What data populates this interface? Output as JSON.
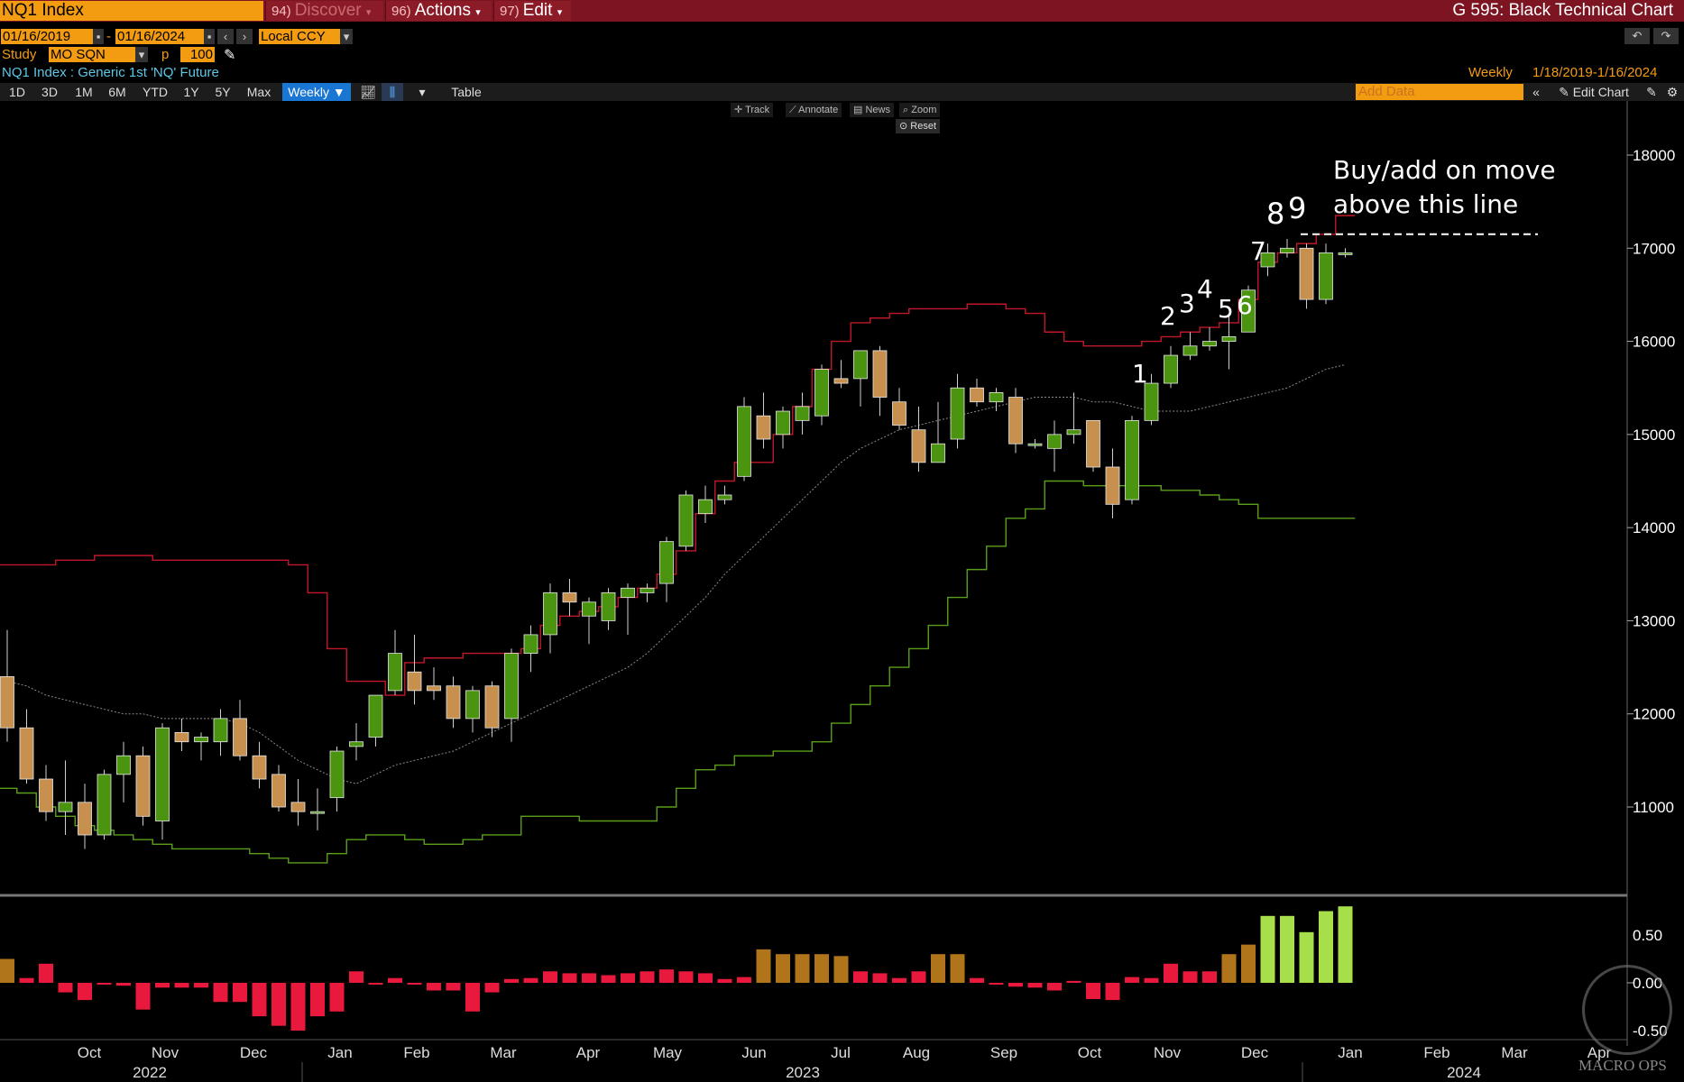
{
  "topbar": {
    "ticker": "NQ1 Index",
    "discover": "Discover",
    "discover_num": "94)",
    "actions": "Actions",
    "actions_num": "96)",
    "edit": "Edit",
    "edit_num": "97)",
    "function_title": "G 595: Black Technical Chart"
  },
  "row2": {
    "start_date": "01/16/2019",
    "end_date": "01/16/2024",
    "currency": "Local CCY",
    "study_label": "Study",
    "study_value": "MO SQN",
    "p_label": "p",
    "p_value": "100"
  },
  "row3": {
    "security_desc": "NQ1 Index : Generic 1st 'NQ' Future",
    "frequency": "Weekly",
    "date_range": "1/18/2019-1/16/2024"
  },
  "rangebar": {
    "buttons": [
      "1D",
      "3D",
      "1M",
      "6M",
      "YTD",
      "1Y",
      "5Y",
      "Max"
    ],
    "period": "Weekly ▼",
    "table": "Table",
    "add_data_placeholder": "Add Data",
    "edit_chart": "Edit Chart"
  },
  "tools": {
    "track": "Track",
    "annotate": "Annotate",
    "news": "News",
    "zoom": "Zoom",
    "reset": "Reset"
  },
  "annotation": {
    "line1": "Buy/add on move",
    "line2": "above this line",
    "counts": [
      "1",
      "2",
      "3",
      "4",
      "5",
      "6",
      "7",
      "8",
      "9"
    ]
  },
  "watermark": "MACRO OPS",
  "colors": {
    "bull": "#4a9410",
    "bear": "#c8904e",
    "upper_band": "#c0182a",
    "lower_band": "#5a9e1a",
    "mid_line": "#8a8a8a",
    "osc_red": "#e8193c",
    "osc_brown": "#b0741a",
    "osc_green": "#a6df4a"
  },
  "chart_data": {
    "type": "candlestick",
    "title": "NQ1 Index : Generic 1st 'NQ' Future",
    "frequency": "Weekly",
    "price_axis": {
      "ylim": [
        10000,
        18700
      ],
      "ticks": [
        11000,
        12000,
        13000,
        14000,
        15000,
        16000,
        17000,
        18000
      ]
    },
    "osc_axis": {
      "ylim": [
        -0.75,
        0.85
      ],
      "ticks": [
        "0.50",
        "0.00",
        "-0.50"
      ]
    },
    "x_months": [
      "Oct",
      "Nov",
      "Dec",
      "Jan",
      "Feb",
      "Mar",
      "Apr",
      "May",
      "Jun",
      "Jul",
      "Aug",
      "Sep",
      "Oct",
      "Nov",
      "Dec",
      "Jan",
      "Feb",
      "Mar",
      "Apr"
    ],
    "x_years": [
      "2022",
      "2023",
      "2024"
    ],
    "candles": [
      [
        12400,
        12900,
        11700,
        11850
      ],
      [
        11850,
        12050,
        11250,
        11300
      ],
      [
        11300,
        11450,
        10850,
        10950
      ],
      [
        10950,
        11500,
        10700,
        11050
      ],
      [
        11050,
        11250,
        10550,
        10700
      ],
      [
        10700,
        11400,
        10650,
        11350
      ],
      [
        11350,
        11700,
        11050,
        11550
      ],
      [
        11550,
        11650,
        10800,
        10900
      ],
      [
        10850,
        11900,
        10650,
        11850
      ],
      [
        11800,
        11950,
        11600,
        11700
      ],
      [
        11700,
        11800,
        11500,
        11750
      ],
      [
        11700,
        12050,
        11550,
        11950
      ],
      [
        11950,
        12150,
        11500,
        11550
      ],
      [
        11550,
        11700,
        11200,
        11300
      ],
      [
        11350,
        11450,
        10950,
        11000
      ],
      [
        11050,
        11300,
        10800,
        10950
      ],
      [
        10950,
        11200,
        10750,
        10950
      ],
      [
        11100,
        11650,
        10950,
        11600
      ],
      [
        11650,
        11900,
        11500,
        11700
      ],
      [
        11750,
        12200,
        11650,
        12200
      ],
      [
        12250,
        12900,
        12200,
        12650
      ],
      [
        12450,
        12850,
        12100,
        12250
      ],
      [
        12300,
        12500,
        12150,
        12250
      ],
      [
        12300,
        12400,
        11850,
        11950
      ],
      [
        11950,
        12300,
        11800,
        12250
      ],
      [
        12300,
        12350,
        11750,
        11850
      ],
      [
        11950,
        12700,
        11700,
        12650
      ],
      [
        12650,
        12950,
        12450,
        12850
      ],
      [
        12850,
        13400,
        12650,
        13300
      ],
      [
        13300,
        13450,
        13050,
        13200
      ],
      [
        13050,
        13250,
        12750,
        13200
      ],
      [
        13000,
        13350,
        12900,
        13300
      ],
      [
        13250,
        13400,
        12850,
        13350
      ],
      [
        13300,
        13400,
        13200,
        13350
      ],
      [
        13400,
        13900,
        13200,
        13850
      ],
      [
        13800,
        14400,
        13750,
        14350
      ],
      [
        14150,
        14450,
        14050,
        14300
      ],
      [
        14300,
        14450,
        14250,
        14350
      ],
      [
        14550,
        15400,
        14500,
        15300
      ],
      [
        15200,
        15450,
        14850,
        14950
      ],
      [
        15000,
        15300,
        14850,
        15250
      ],
      [
        15150,
        15450,
        15000,
        15300
      ],
      [
        15200,
        15750,
        15100,
        15700
      ],
      [
        15600,
        15800,
        15500,
        15550
      ],
      [
        15600,
        15900,
        15300,
        15900
      ],
      [
        15900,
        15950,
        15200,
        15400
      ],
      [
        15350,
        15500,
        15050,
        15100
      ],
      [
        15050,
        15300,
        14600,
        14700
      ],
      [
        14700,
        15350,
        14700,
        14900
      ],
      [
        14950,
        15650,
        14850,
        15500
      ],
      [
        15500,
        15600,
        15300,
        15350
      ],
      [
        15350,
        15500,
        15250,
        15450
      ],
      [
        15400,
        15500,
        14800,
        14900
      ],
      [
        14900,
        14950,
        14850,
        14900
      ],
      [
        14850,
        15150,
        14600,
        15000
      ],
      [
        15000,
        15450,
        14900,
        15050
      ],
      [
        15150,
        15150,
        14600,
        14650
      ],
      [
        14650,
        14850,
        14100,
        14250
      ],
      [
        14300,
        15200,
        14250,
        15150
      ],
      [
        15150,
        15650,
        15100,
        15550
      ],
      [
        15550,
        15950,
        15500,
        15850
      ],
      [
        15850,
        16100,
        15800,
        15950
      ],
      [
        15950,
        16150,
        15900,
        16000
      ],
      [
        16000,
        16300,
        15700,
        16050
      ],
      [
        16100,
        16600,
        16100,
        16550
      ],
      [
        16800,
        17050,
        16700,
        16950
      ],
      [
        16950,
        17100,
        16900,
        17000
      ],
      [
        17000,
        17050,
        16350,
        16450
      ],
      [
        16450,
        17050,
        16400,
        16950
      ],
      [
        16950,
        17000,
        16900,
        16950
      ]
    ],
    "upper_band": [
      13600,
      13600,
      13600,
      13650,
      13650,
      13700,
      13700,
      13700,
      13650,
      13650,
      13650,
      13650,
      13650,
      13650,
      13650,
      13600,
      13300,
      12700,
      12350,
      12350,
      12200,
      12550,
      12600,
      12600,
      12650,
      12650,
      12650,
      12700,
      12950,
      13050,
      13100,
      13150,
      13250,
      13350,
      13500,
      13750,
      14150,
      14500,
      14700,
      14700,
      15000,
      15300,
      15700,
      16000,
      16200,
      16250,
      16300,
      16350,
      16350,
      16350,
      16400,
      16400,
      16350,
      16300,
      16100,
      16000,
      15950,
      15950,
      15950,
      16000,
      16050,
      16100,
      16150,
      16200,
      16450,
      16850,
      16950,
      17050,
      17150,
      17350
    ],
    "mid_line": [
      12350,
      12300,
      12200,
      12150,
      12100,
      12050,
      12000,
      12000,
      11950,
      11950,
      11950,
      11950,
      11900,
      11800,
      11650,
      11500,
      11400,
      11300,
      11250,
      11350,
      11450,
      11500,
      11550,
      11600,
      11700,
      11800,
      11900,
      12000,
      12100,
      12200,
      12300,
      12400,
      12500,
      12650,
      12850,
      13050,
      13250,
      13500,
      13700,
      13900,
      14100,
      14300,
      14500,
      14700,
      14850,
      14950,
      15050,
      15100,
      15150,
      15200,
      15250,
      15300,
      15350,
      15400,
      15400,
      15400,
      15350,
      15350,
      15300,
      15250,
      15250,
      15250,
      15300,
      15350,
      15400,
      15450,
      15500,
      15600,
      15700,
      15750
    ],
    "lower_band": [
      11200,
      11150,
      11000,
      10900,
      10800,
      10750,
      10700,
      10650,
      10600,
      10550,
      10550,
      10550,
      10550,
      10500,
      10450,
      10400,
      10400,
      10500,
      10650,
      10700,
      10700,
      10650,
      10600,
      10600,
      10650,
      10700,
      10700,
      10900,
      10900,
      10900,
      10850,
      10850,
      10850,
      10850,
      11000,
      11200,
      11400,
      11450,
      11550,
      11550,
      11600,
      11600,
      11700,
      11900,
      12100,
      12300,
      12500,
      12700,
      12950,
      13250,
      13550,
      13800,
      14100,
      14200,
      14500,
      14500,
      14450,
      14450,
      14450,
      14450,
      14400,
      14400,
      14350,
      14300,
      14250,
      14100,
      14100,
      14100,
      14100,
      14100
    ],
    "oscillator": [
      0.25,
      0.05,
      0.2,
      -0.1,
      -0.18,
      -0.01,
      -0.03,
      -0.28,
      -0.05,
      -0.05,
      -0.05,
      -0.2,
      -0.2,
      -0.35,
      -0.45,
      -0.5,
      -0.35,
      -0.3,
      0.12,
      0.0,
      0.05,
      0.0,
      -0.08,
      -0.08,
      -0.3,
      -0.1,
      0.04,
      0.05,
      0.12,
      0.1,
      0.1,
      0.08,
      0.1,
      0.12,
      0.14,
      0.12,
      0.1,
      0.04,
      0.06,
      0.35,
      0.3,
      0.3,
      0.3,
      0.28,
      0.12,
      0.1,
      0.05,
      0.12,
      0.3,
      0.3,
      0.05,
      0.0,
      -0.04,
      -0.05,
      -0.08,
      0.02,
      -0.17,
      -0.18,
      0.06,
      0.05,
      0.2,
      0.12,
      0.12,
      0.3,
      0.4,
      0.7,
      0.7,
      0.53,
      0.75,
      0.8
    ],
    "resistance_line": 17150
  }
}
